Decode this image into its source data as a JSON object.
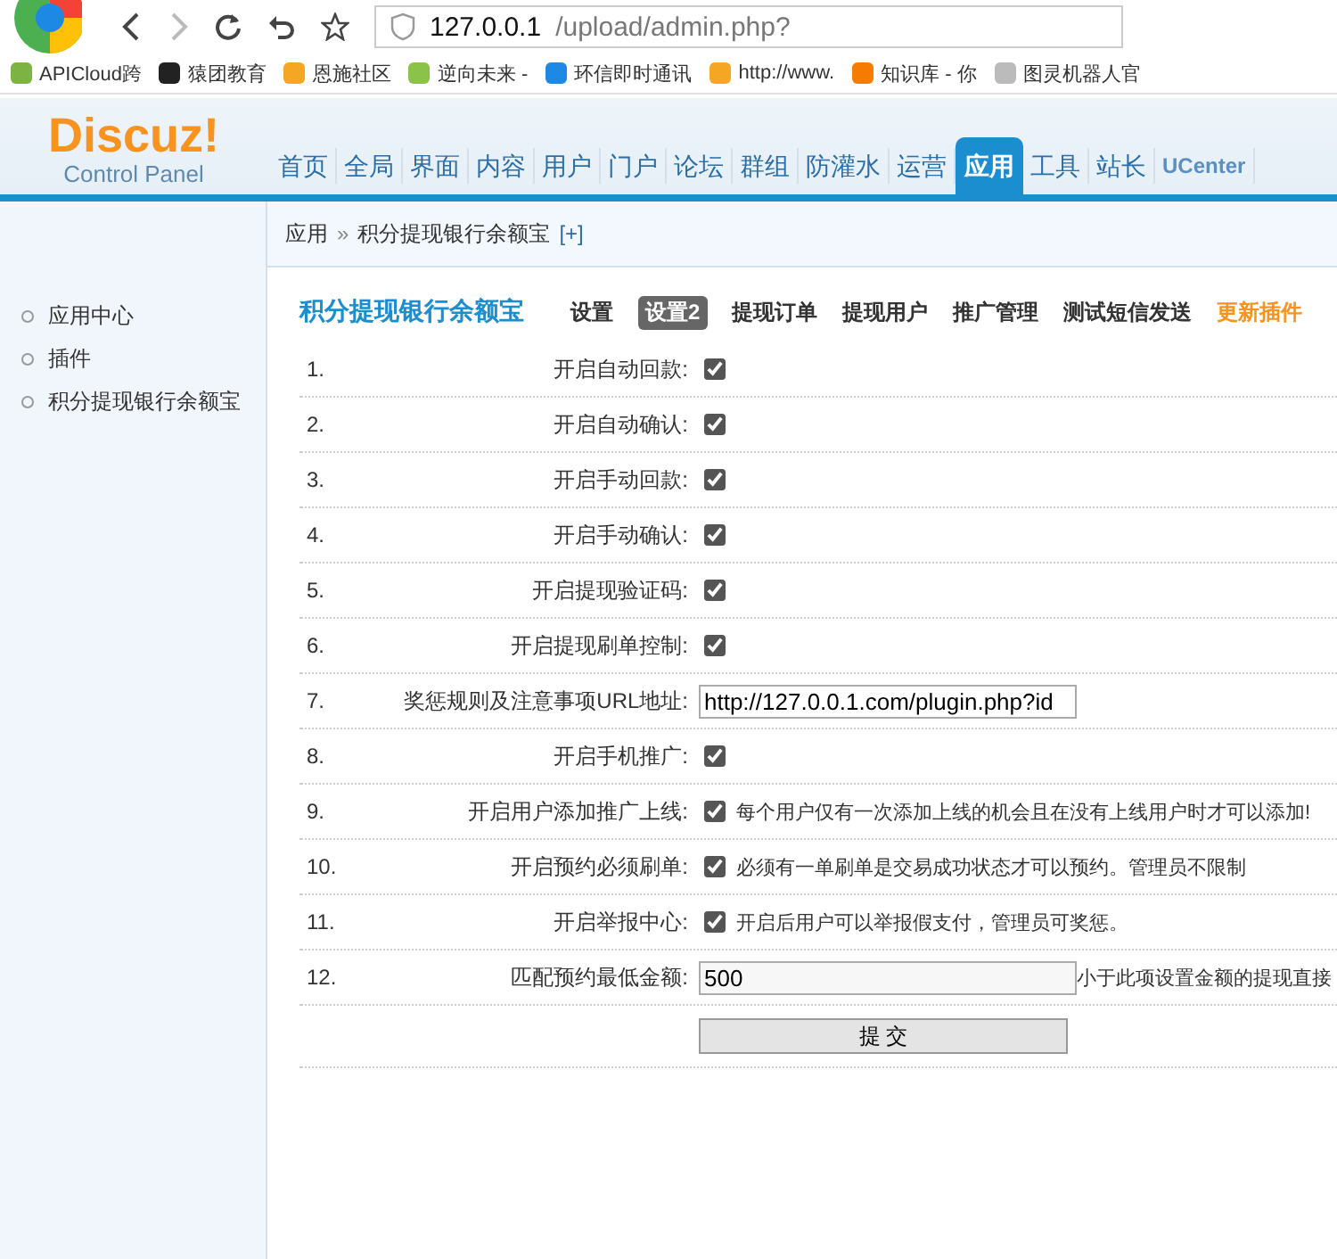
{
  "browser": {
    "address_host": "127.0.0.1",
    "address_path": "/upload/admin.php?"
  },
  "bookmarks": [
    {
      "label": "APICloud跨",
      "color": "#7cb342"
    },
    {
      "label": "猿团教育",
      "color": "#222222"
    },
    {
      "label": "恩施社区",
      "color": "#f5a623"
    },
    {
      "label": "逆向未来 -",
      "color": "#8bc34a"
    },
    {
      "label": "环信即时通讯",
      "color": "#1e88e5"
    },
    {
      "label": "http://www.",
      "color": "#f5a623"
    },
    {
      "label": "知识库 - 你",
      "color": "#f57c00"
    },
    {
      "label": "图灵机器人官",
      "color": "#bbbbbb"
    }
  ],
  "logo": {
    "title": "Discuz!",
    "subtitle": "Control Panel"
  },
  "nav": [
    {
      "label": "首页",
      "selected": false
    },
    {
      "label": "全局",
      "selected": false
    },
    {
      "label": "界面",
      "selected": false
    },
    {
      "label": "内容",
      "selected": false
    },
    {
      "label": "用户",
      "selected": false
    },
    {
      "label": "门户",
      "selected": false
    },
    {
      "label": "论坛",
      "selected": false
    },
    {
      "label": "群组",
      "selected": false
    },
    {
      "label": "防灌水",
      "selected": false
    },
    {
      "label": "运营",
      "selected": false
    },
    {
      "label": "应用",
      "selected": true
    },
    {
      "label": "工具",
      "selected": false
    },
    {
      "label": "站长",
      "selected": false
    },
    {
      "label": "UCenter",
      "selected": false
    }
  ],
  "breadcrumb": {
    "parent": "应用",
    "separator": "»",
    "current": "积分提现银行余额宝",
    "add": "[+]"
  },
  "sidebar": {
    "items": [
      "应用中心",
      "插件",
      "积分提现银行余额宝"
    ]
  },
  "plugin": {
    "title": "积分提现银行余额宝",
    "tabs": [
      {
        "label": "设置",
        "selected": false,
        "kind": "tab"
      },
      {
        "label": "设置2",
        "selected": true,
        "kind": "tab"
      },
      {
        "label": "提现订单",
        "selected": false,
        "kind": "tab"
      },
      {
        "label": "提现用户",
        "selected": false,
        "kind": "tab"
      },
      {
        "label": "推广管理",
        "selected": false,
        "kind": "tab"
      },
      {
        "label": "测试短信发送",
        "selected": false,
        "kind": "tab"
      },
      {
        "label": "更新插件",
        "selected": false,
        "kind": "update"
      }
    ]
  },
  "settings": [
    {
      "number": "1.",
      "label": "开启自动回款:",
      "kind": "checkbox",
      "checked": true
    },
    {
      "number": "2.",
      "label": "开启自动确认:",
      "kind": "checkbox",
      "checked": true
    },
    {
      "number": "3.",
      "label": "开启手动回款:",
      "kind": "checkbox",
      "checked": true
    },
    {
      "number": "4.",
      "label": "开启手动确认:",
      "kind": "checkbox",
      "checked": true
    },
    {
      "number": "5.",
      "label": "开启提现验证码:",
      "kind": "checkbox",
      "checked": true
    },
    {
      "number": "6.",
      "label": "开启提现刷单控制:",
      "kind": "checkbox",
      "checked": true
    },
    {
      "number": "7.",
      "label": "奖惩规则及注意事项URL地址:",
      "kind": "text",
      "value": "http://127.0.0.1.com/plugin.php?id"
    },
    {
      "number": "8.",
      "label": "开启手机推广:",
      "kind": "checkbox",
      "checked": true
    },
    {
      "number": "9.",
      "label": "开启用户添加推广上线:",
      "kind": "checkbox",
      "checked": true,
      "note": "每个用户仅有一次添加上线的机会且在没有上线用户时才可以添加!"
    },
    {
      "number": "10.",
      "label": "开启预约必须刷单:",
      "kind": "checkbox",
      "checked": true,
      "note": "必须有一单刷单是交易成功状态才可以预约。管理员不限制"
    },
    {
      "number": "11.",
      "label": "开启举报中心:",
      "kind": "checkbox",
      "checked": true,
      "note": "开启后用户可以举报假支付，管理员可奖惩。"
    },
    {
      "number": "12.",
      "label": "匹配预约最低金额:",
      "kind": "wide",
      "value": "500",
      "note": "小于此项设置金额的提现直接"
    }
  ],
  "submit": "提 交"
}
